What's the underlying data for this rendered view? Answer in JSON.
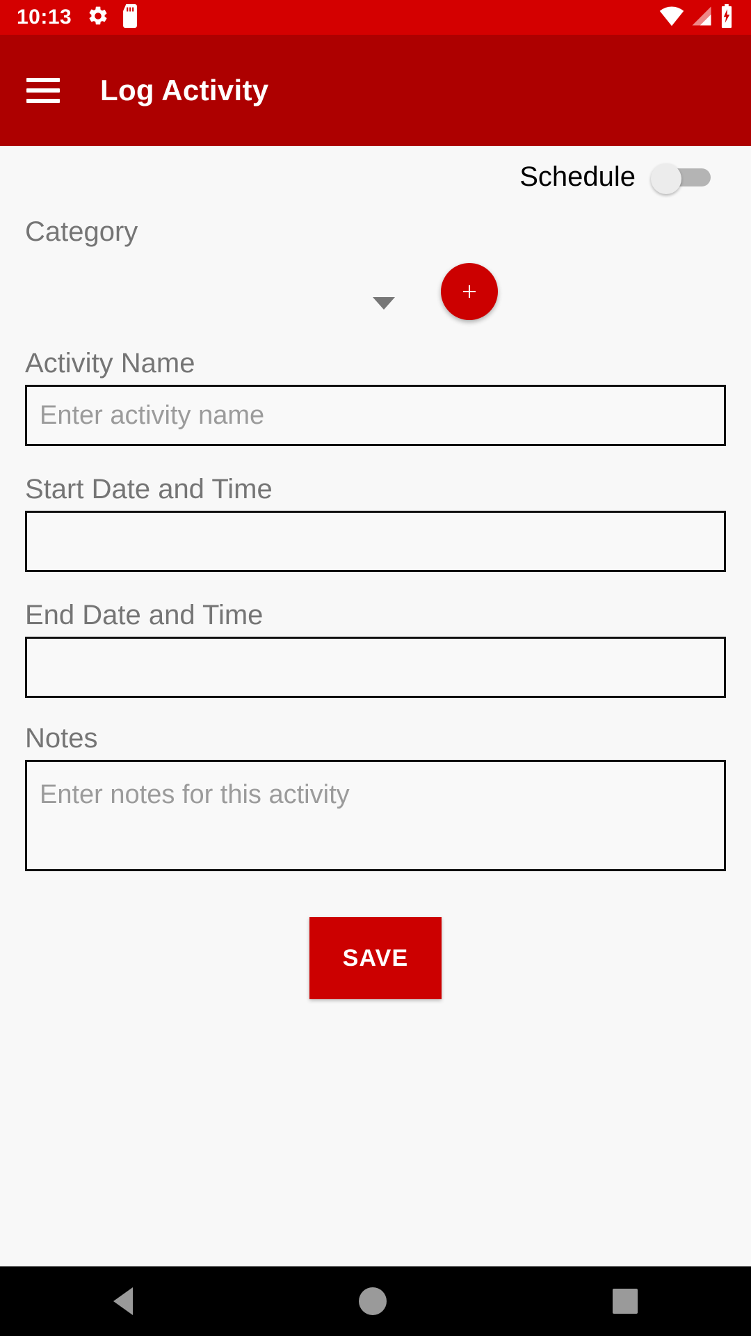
{
  "status_bar": {
    "time": "10:13",
    "left_icons": [
      "gear-icon",
      "sd-card-icon"
    ],
    "right_icons": [
      "wifi-icon",
      "cellular-signal-icon",
      "battery-charging-icon"
    ],
    "background_color": "#D40000"
  },
  "app_bar": {
    "menu_icon": "hamburger-menu-icon",
    "title": "Log Activity",
    "background_color": "#AD0000"
  },
  "form": {
    "schedule": {
      "label": "Schedule",
      "toggle_state": "off"
    },
    "category": {
      "label": "Category",
      "selected_value": "",
      "dropdown_icon": "chevron-down-icon",
      "add_button_icon": "plus-icon",
      "add_button_color": "#CC0000"
    },
    "activity_name": {
      "label": "Activity Name",
      "value": "",
      "placeholder": "Enter activity name"
    },
    "start_datetime": {
      "label": "Start Date and Time",
      "value": "",
      "placeholder": ""
    },
    "end_datetime": {
      "label": "End Date and Time",
      "value": "",
      "placeholder": ""
    },
    "notes": {
      "label": "Notes",
      "value": "",
      "placeholder": "Enter notes for this activity"
    },
    "save_button": {
      "label": "SAVE",
      "color": "#CC0000"
    }
  },
  "nav_bar": {
    "back_icon": "back-triangle-icon",
    "home_icon": "home-circle-icon",
    "recents_icon": "recents-square-icon"
  }
}
